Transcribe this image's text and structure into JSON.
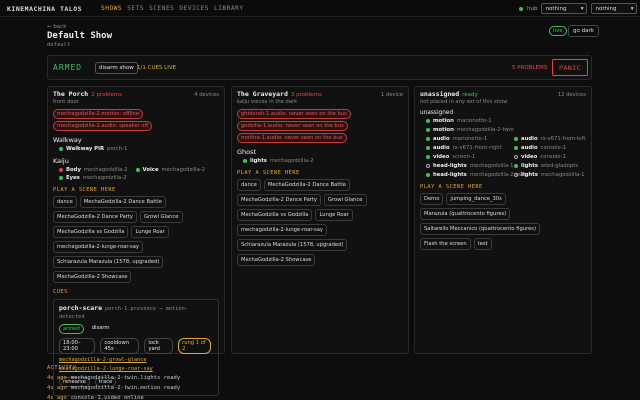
{
  "app": {
    "brand": "KINEMACHINA TALOS"
  },
  "nav": [
    "SHOWS",
    "SETS",
    "SCENES",
    "DEVICES",
    "LIBRARY"
  ],
  "hub": {
    "label": "hub",
    "select1": "nothing",
    "select2": "nothing",
    "status_color": "#3fbf5a"
  },
  "header": {
    "back": "← back",
    "title": "Default Show",
    "subtitle": "default",
    "live": "live",
    "go_dark": "go dark"
  },
  "armbar": {
    "state": "ARMED",
    "disarm": "disarm show",
    "cues_live": "1/1 CUES LIVE",
    "problems": "5 PROBLEMS",
    "panic": "PANIC"
  },
  "colors": {
    "accent": "#e3a832",
    "ok": "#3fbf5a",
    "error": "#e34646"
  },
  "sets": [
    {
      "name": "The Porch",
      "problems": "2 problems",
      "count": "4 devices",
      "desc": "front door",
      "errors": [
        "mechagodzilla-2.motion: offline",
        "mechagodzilla-2.audio: speaker off"
      ],
      "groups": [
        {
          "name": "Walkway",
          "devices": [
            {
              "name": "Walkway PIR",
              "device": "porch-1",
              "status": "ok"
            }
          ]
        },
        {
          "name": "Kaiju",
          "devices": [
            {
              "name": "Body",
              "device": "mechagodzilla-2",
              "status": "error"
            },
            {
              "name": "Voice",
              "device": "mechagodzilla-2",
              "status": "ok"
            },
            {
              "name": "Eyes",
              "device": "mechagodzilla-2",
              "status": "ok"
            }
          ]
        }
      ],
      "scenes_label": "PLAY A SCENE HERE",
      "scenes": [
        "dance",
        "MechaGodzilla-2 Dance Battle",
        "MechaGodzilla-2 Dance Party",
        "Growl Glance",
        "MechaGodzilla vs Godzilla",
        "Lunge Roar",
        "mechagodzilla-2-lunge-roar-say",
        "Schiarazula Marazula (1578, upgraded)",
        "MechaGodzilla-2 Showcase"
      ],
      "cues_label": "CUES",
      "cue": {
        "name": "porch-scare",
        "trigger": "porch-1.presence → motion-detected",
        "state_chips": [
          "armed",
          "disarm"
        ],
        "time_chips": [
          "18:00–23:00",
          "cooldown 45s",
          "lock yard",
          "rung 1 of 2"
        ],
        "links": [
          "mechagodzilla-2-growl-glance",
          "mechagodzilla-2-lunge-roar-say"
        ],
        "actions": [
          "rehearse",
          "trace"
        ]
      }
    },
    {
      "name": "The Graveyard",
      "problems": "3 problems",
      "count": "1 device",
      "desc": "kaiju voices in the dark",
      "errors": [
        "ghidorah-1.audio: never seen on the bus",
        "godzilla-1.audio: never seen on the bus",
        "mothra-1.audio: never seen on the bus"
      ],
      "groups": [
        {
          "name": "Ghost",
          "devices": [
            {
              "name": "lights",
              "device": "mechagodzilla-2",
              "status": "ok"
            }
          ]
        }
      ],
      "scenes_label": "PLAY A SCENE HERE",
      "scenes": [
        "dance",
        "MechaGodzilla-2 Dance Battle",
        "MechaGodzilla-2 Dance Party",
        "Growl Glance",
        "MechaGodzilla vs Godzilla",
        "Lunge Roar",
        "mechagodzilla-2-lunge-roar-say",
        "Schiarazula Marazula (1578, upgraded)",
        "MechaGodzilla-2 Showcase"
      ]
    },
    {
      "name": "unassigned",
      "status": "ready",
      "count": "12 devices",
      "desc": "not placed in any set of this show",
      "group_name": "unassigned",
      "devices": [
        {
          "name": "motion",
          "device": "marionette-1",
          "status": "ok"
        },
        {
          "name": "motion",
          "device": "mechagodzilla-2-twin",
          "status": "ok"
        },
        {
          "name": "audio",
          "device": "marionette-1",
          "status": "ok"
        },
        {
          "name": "audio",
          "device": "rx-v671-from-left",
          "status": "ok"
        },
        {
          "name": "audio",
          "device": "rx-v671-front-right",
          "status": "ok"
        },
        {
          "name": "audio",
          "device": "console-1",
          "status": "ok"
        },
        {
          "name": "video",
          "device": "screen-1",
          "status": "ok"
        },
        {
          "name": "video",
          "device": "console-1",
          "status": "hollow"
        },
        {
          "name": "head-lights",
          "device": "mechagodzilla-1",
          "status": "hollow"
        },
        {
          "name": "lights",
          "device": "wled-gladopts",
          "status": "ok"
        },
        {
          "name": "head-lights",
          "device": "mechagodzilla-2-twin",
          "status": "ok"
        },
        {
          "name": "lights",
          "device": "mechagodzilla-1",
          "status": "hollow"
        }
      ],
      "scenes_label": "PLAY A SCENE HERE",
      "scenes": [
        "Demo",
        "jumping_dance_30s",
        "Marazula (quattrocento figures)",
        "Saltarello Meccanico (quattrocento figures)",
        "Flash the screen",
        "test"
      ]
    }
  ],
  "activity": {
    "title": "ACTIVITY",
    "items": [
      {
        "time": "4s ago",
        "text": "mechagodzilla-2-twin.lights ready"
      },
      {
        "time": "4s ago",
        "text": "mechagodzilla-2-twin.motion ready"
      },
      {
        "time": "4s ago",
        "text": "console-1.video online"
      }
    ]
  }
}
